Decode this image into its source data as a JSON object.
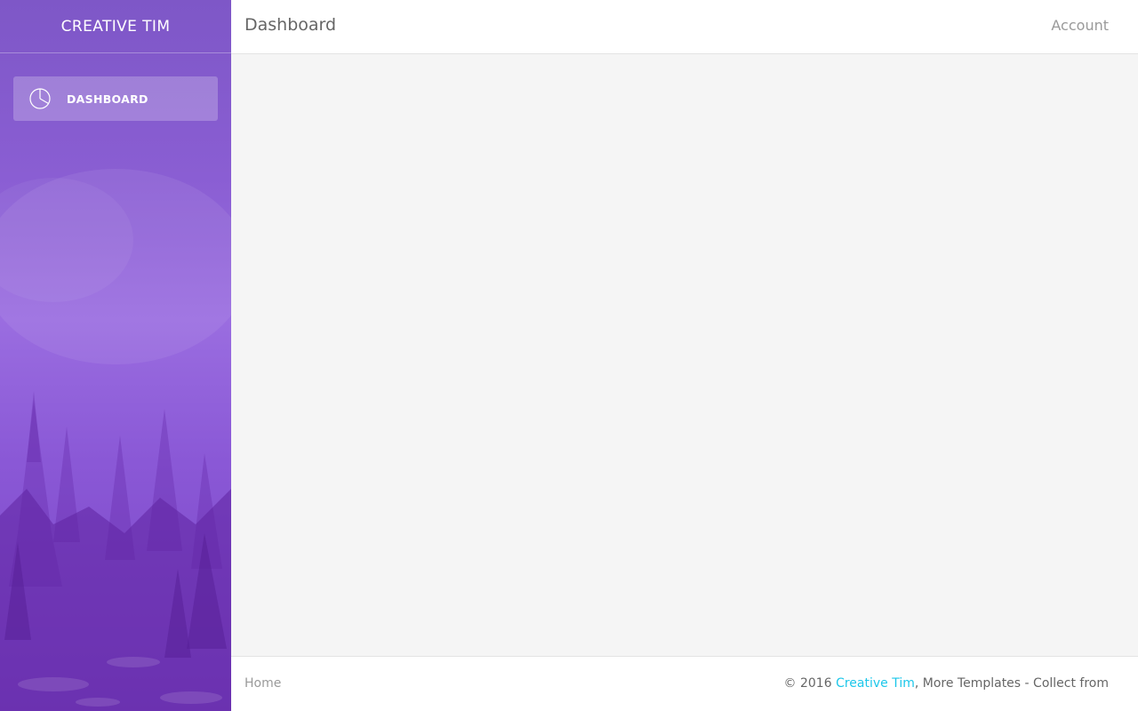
{
  "sidebar": {
    "logo": "CREATIVE TIM",
    "items": [
      {
        "label": "DASHBOARD",
        "icon": "pie-chart-icon",
        "active": true
      }
    ]
  },
  "header": {
    "title": "Dashboard",
    "account": "Account"
  },
  "footer": {
    "home": "Home",
    "copyright_prefix": "© 2016 ",
    "copyright_link": "Creative Tim",
    "copyright_suffix": ", More Templates - Collect from"
  },
  "colors": {
    "sidebar_purple": "#8a5ed3",
    "link_cyan": "#1dc7ea",
    "background": "#f5f5f5"
  }
}
